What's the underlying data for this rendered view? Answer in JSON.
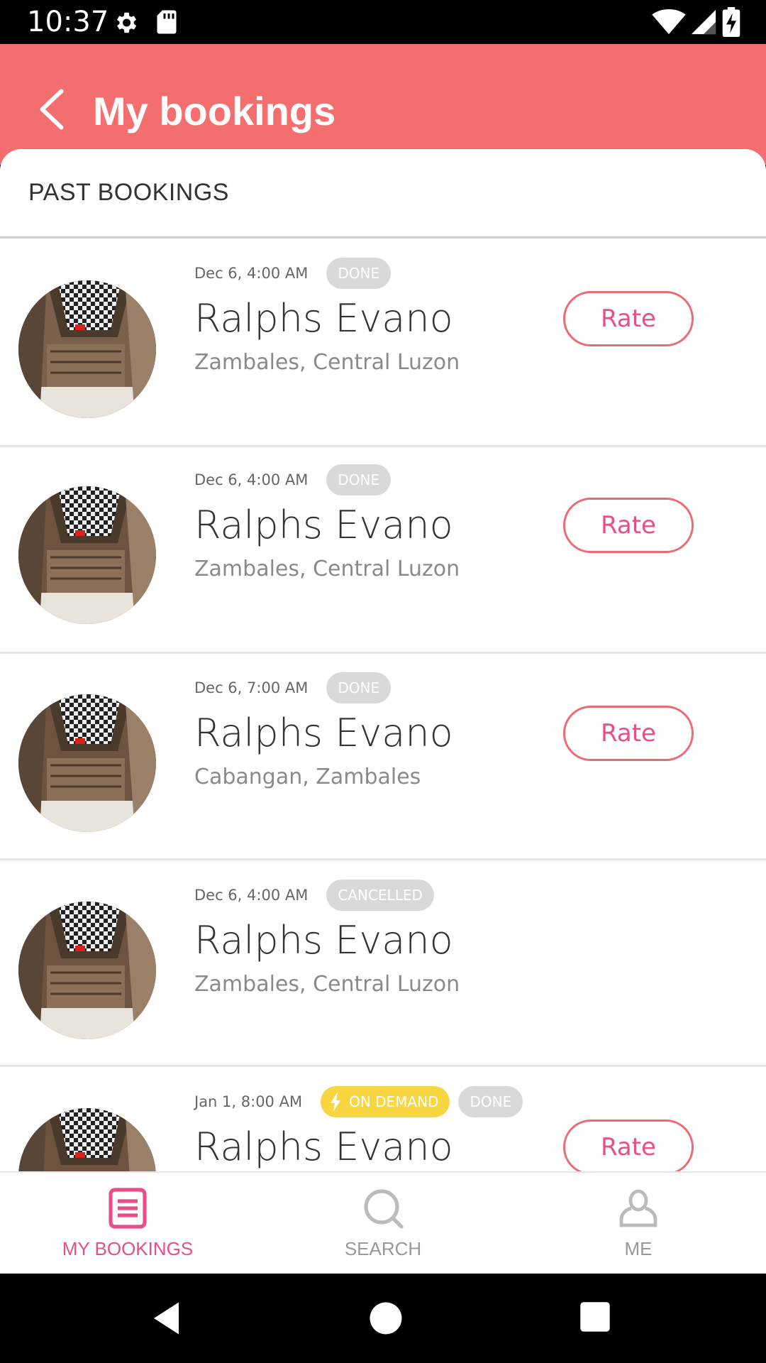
{
  "status_bar": {
    "time": "10:37"
  },
  "header": {
    "title": "My bookings"
  },
  "section": {
    "title": "PAST BOOKINGS"
  },
  "bookings": [
    {
      "date": "Dec 6, 4:00 AM",
      "status": "DONE",
      "name": "Ralphs Evano",
      "location": "Zambales, Central Luzon",
      "action": "Rate"
    },
    {
      "date": "Dec 6, 4:00 AM",
      "status": "DONE",
      "name": "Ralphs Evano",
      "location": "Zambales, Central Luzon",
      "action": "Rate"
    },
    {
      "date": "Dec 6, 7:00 AM",
      "status": "DONE",
      "name": "Ralphs Evano",
      "location": "Cabangan, Zambales",
      "action": "Rate"
    },
    {
      "date": "Dec 6, 4:00 AM",
      "status": "CANCELLED",
      "name": "Ralphs Evano",
      "location": "Zambales, Central Luzon"
    },
    {
      "date": "Jan 1, 8:00 AM",
      "tag": "ON DEMAND",
      "status": "DONE",
      "name": "Ralphs Evano",
      "action": "Rate"
    }
  ],
  "bottom_nav": {
    "items": [
      {
        "label": "MY BOOKINGS",
        "icon": "bookings-list-icon",
        "active": true
      },
      {
        "label": "SEARCH",
        "icon": "search-icon",
        "active": false
      },
      {
        "label": "ME",
        "icon": "user-icon",
        "active": false
      }
    ]
  },
  "colors": {
    "header_bg": "#f36f6f",
    "accent_pink": "#e84f8a",
    "rate_border": "#ee6a73",
    "badge_grey": "#d9d9d9",
    "on_demand_yellow": "#f7d642"
  }
}
